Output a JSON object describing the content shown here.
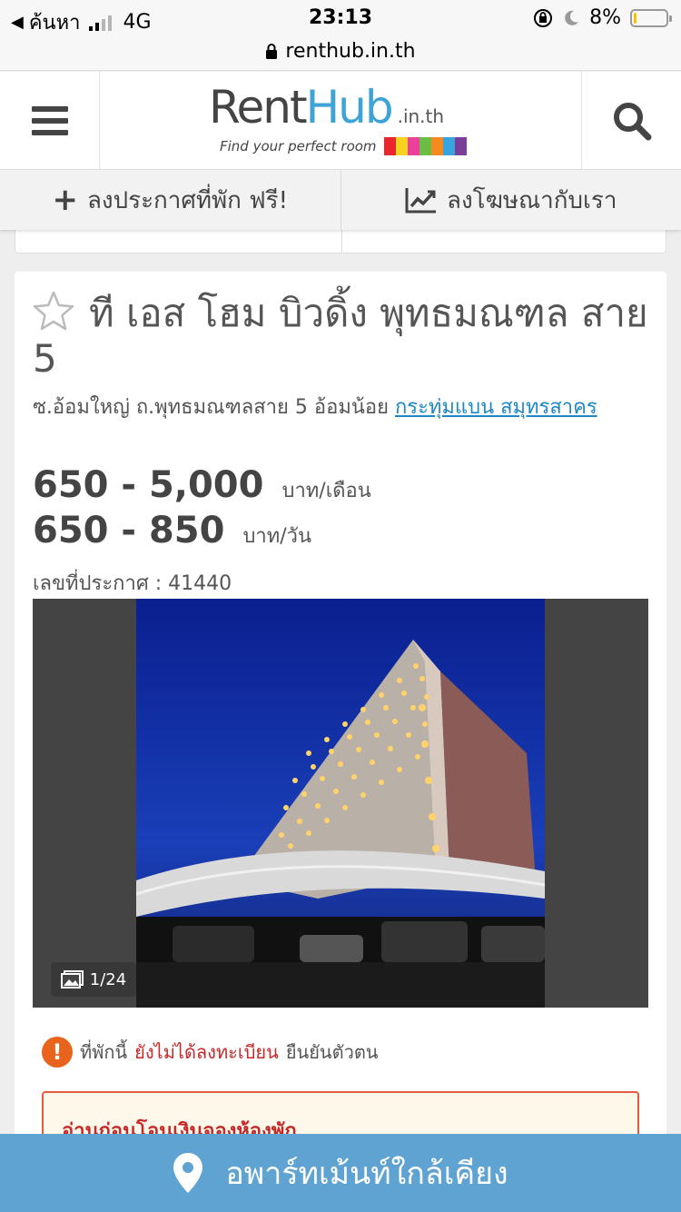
{
  "status_bar": {
    "back_label": "ค้นหา",
    "network": "4G",
    "time": "23:13",
    "battery": "8%",
    "battery_level": 0.08
  },
  "url_bar": {
    "url": "renthub.in.th"
  },
  "header": {
    "logo_rent": "Rent",
    "logo_hub": "Hub",
    "logo_tld": ".in.th",
    "tagline": "Find your perfect room",
    "logo_colors": [
      "#e8262c",
      "#f7d21e",
      "#ea3f9a",
      "#6bbd45",
      "#f58b1f",
      "#37a4dc",
      "#7a3f98"
    ]
  },
  "actions": {
    "post_free": "ลงประกาศที่พัก ฟรี!",
    "advertise": "ลงโฆษณากับเรา"
  },
  "listing": {
    "title": "ที เอส โฮม บิวดิ้ง พุทธมณฑล สาย 5",
    "address_text": "ซ.อ้อมใหญ่ ถ.พุทธมณฑลสาย 5 อ้อมน้อย",
    "address_link": "กระทุ่มแบน สมุทรสาคร",
    "price_month": "650 - 5,000",
    "unit_month": "บาท/เดือน",
    "price_day": "650 - 850",
    "unit_day": "บาท/วัน",
    "listing_no": "เลขที่ประกาศ : 41440",
    "photo_counter": "1/24"
  },
  "warning": {
    "prefix": "ที่พักนี้",
    "highlight": "ยังไม่ได้ลงทะเบียน",
    "suffix": "ยืนยันตัวตน"
  },
  "notice": {
    "title": "อ่านก่อนโอนเงินจองห้องพัก"
  },
  "bottom_bar": {
    "label": "อพาร์ทเม้นท์ใกล้เคียง"
  }
}
